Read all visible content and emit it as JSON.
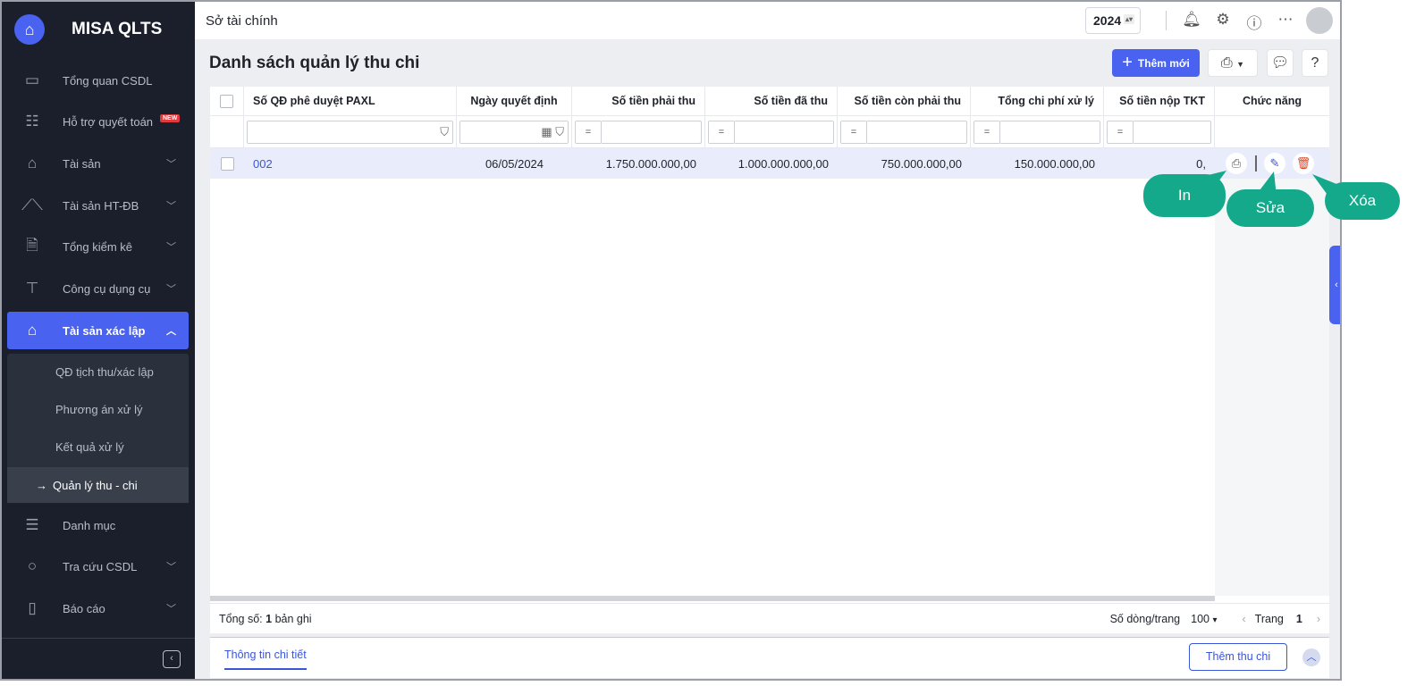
{
  "app": {
    "name": "MISA QLTS"
  },
  "sidebar": {
    "items": [
      {
        "label": "Tổng quan CSDL",
        "icon": "monitor-chart-icon"
      },
      {
        "label": "Hỗ trợ quyết toán",
        "icon": "clipboard-icon",
        "badge": "NEW"
      },
      {
        "label": "Tài sản",
        "icon": "house-car-icon"
      },
      {
        "label": "Tài sản HT-ĐB",
        "icon": "road-icon"
      },
      {
        "label": "Tổng kiểm kê",
        "icon": "document-check-icon"
      },
      {
        "label": "Công cụ dụng cụ",
        "icon": "paint-roller-icon"
      },
      {
        "label": "Tài sản xác lập",
        "icon": "house-car-icon"
      },
      {
        "label": "Danh mục",
        "icon": "list-icon"
      },
      {
        "label": "Tra cứu CSDL",
        "icon": "search-icon"
      },
      {
        "label": "Báo cáo",
        "icon": "bar-chart-icon"
      }
    ],
    "subitems": [
      "QĐ tịch thu/xác lập",
      "Phương án xử lý",
      "Kết quả xử lý",
      "Quản lý thu - chi"
    ]
  },
  "topbar": {
    "org": "Sở tài chính",
    "year": "2024"
  },
  "page": {
    "title": "Danh sách quản lý thu chi",
    "add_label": "Thêm mới"
  },
  "table": {
    "columns": [
      "Số QĐ phê duyệt PAXL",
      "Ngày quyết định",
      "Số tiền phải thu",
      "Số tiền đã thu",
      "Số tiền còn phải thu",
      "Tổng chi phí xử lý",
      "Số tiền nộp TKT",
      "Chức năng"
    ],
    "filter_op": "=",
    "rows": [
      {
        "code": "002",
        "date": "06/05/2024",
        "receivable": "1.750.000.000,00",
        "received": "1.000.000.000,00",
        "remaining": "750.000.000,00",
        "cost": "150.000.000,00",
        "paid": "0,"
      }
    ]
  },
  "footer": {
    "total_label": "Tổng số:",
    "total": "1",
    "total_suffix": "bản ghi",
    "rows_label": "Số dòng/trang",
    "rows_per_page": "100",
    "page_label": "Trang",
    "page": "1"
  },
  "detail": {
    "tab": "Thông tin chi tiết",
    "add_label": "Thêm thu chi"
  },
  "callouts": {
    "print": "In",
    "edit": "Sửa",
    "delete": "Xóa"
  },
  "colors": {
    "accent": "#4a62f0",
    "sidebar": "#1b1f2b",
    "callout": "#14a98a"
  }
}
